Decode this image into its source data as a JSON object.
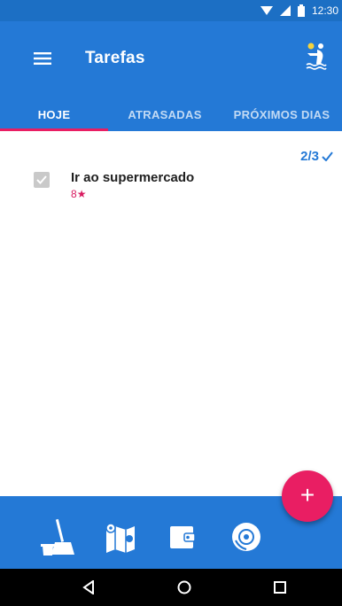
{
  "status_bar": {
    "time": "12:30"
  },
  "app_bar": {
    "title": "Tarefas"
  },
  "tabs": [
    {
      "label": "HOJE",
      "active": true
    },
    {
      "label": "ATRASADAS",
      "active": false
    },
    {
      "label": "PRÓXIMOS DIAS",
      "active": false
    }
  ],
  "progress": {
    "text": "2/3"
  },
  "tasks": [
    {
      "title": "Ir ao supermercado",
      "points": "8",
      "checked": true
    }
  ],
  "bottom_nav": [
    {
      "icon": "broom-bucket-icon"
    },
    {
      "icon": "map-icon"
    },
    {
      "icon": "wallet-icon"
    },
    {
      "icon": "disc-icon"
    }
  ],
  "fab": {
    "label": "+"
  },
  "colors": {
    "primary": "#2479d6",
    "accent": "#e91e63",
    "status": "#1c6fc4"
  }
}
